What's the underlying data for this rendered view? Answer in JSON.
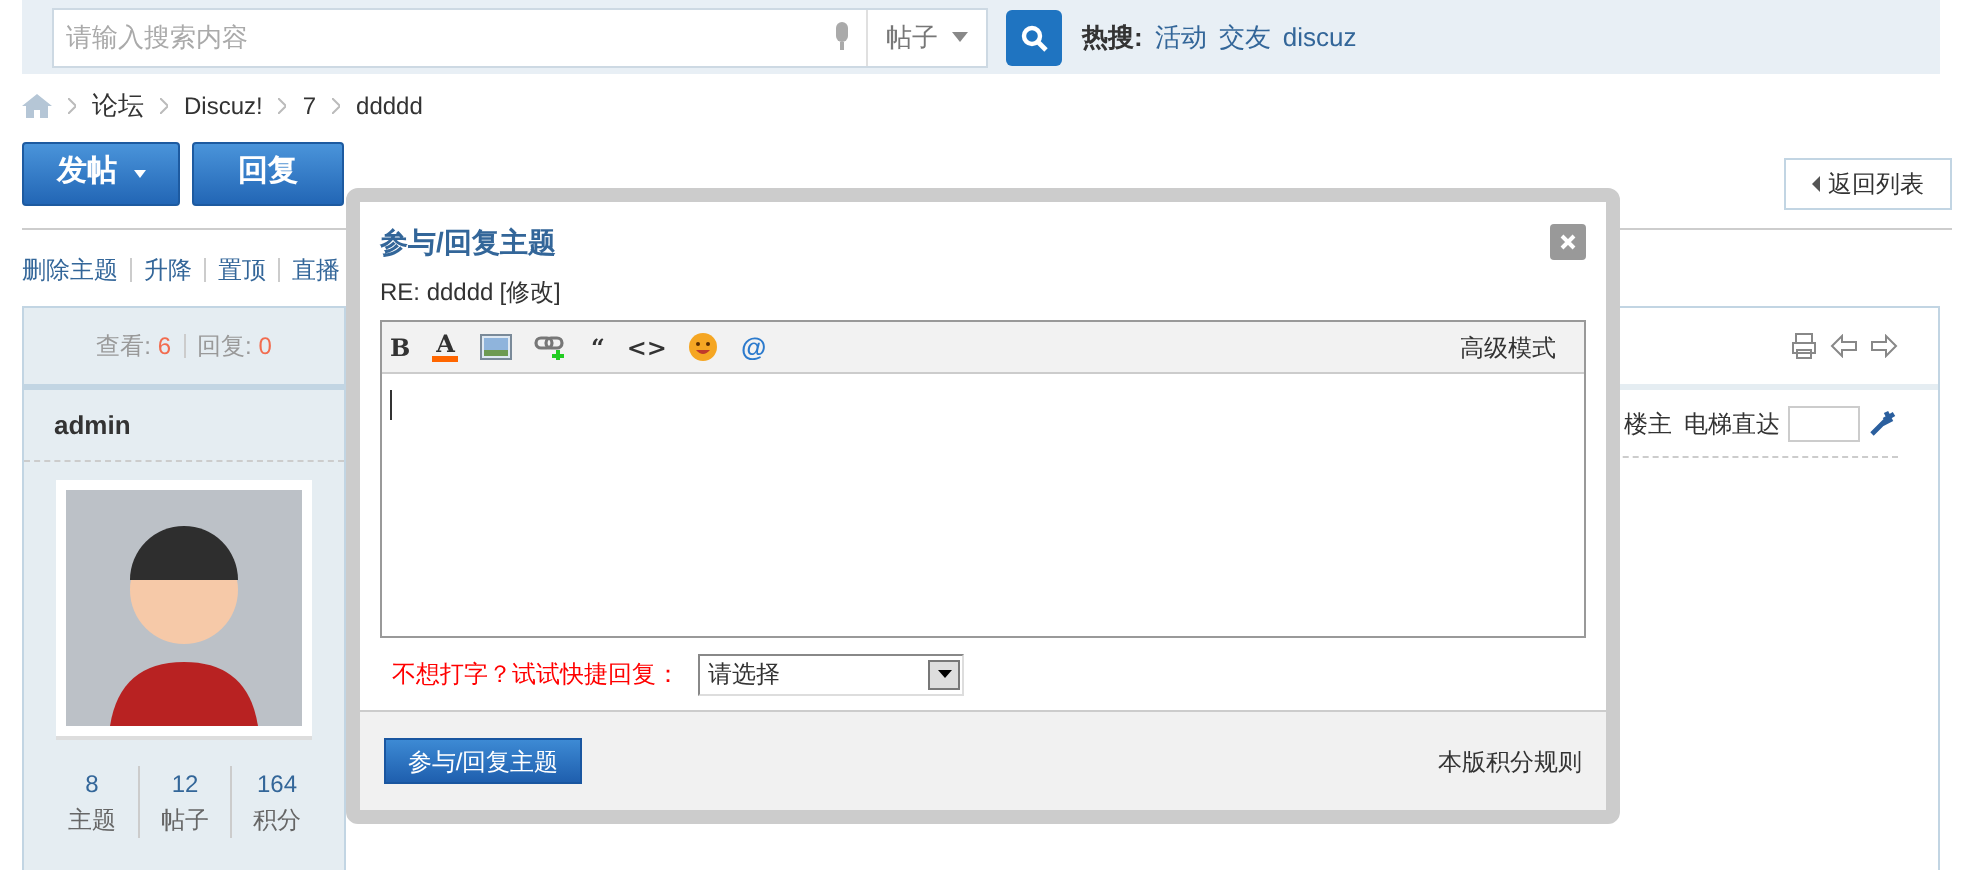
{
  "search": {
    "placeholder": "请输入搜索内容",
    "type_select": "帖子",
    "hot_label": "热搜:",
    "hot_links": [
      "活动",
      "交友",
      "discuz"
    ]
  },
  "breadcrumb": [
    "论坛",
    "Discuz!",
    "7",
    "ddddd"
  ],
  "actions": {
    "post_button": "发帖",
    "reply_button": "回复",
    "back_button": "返回列表"
  },
  "mod_actions": [
    "删除主题",
    "升降",
    "置顶",
    "直播"
  ],
  "thread_stats": [
    {
      "label": "查看:",
      "value": "6"
    },
    {
      "label": "回复:",
      "value": "0"
    }
  ],
  "author": {
    "name": "admin",
    "stats": [
      {
        "value": "8",
        "label": "主题"
      },
      {
        "value": "12",
        "label": "帖子"
      },
      {
        "value": "164",
        "label": "积分"
      }
    ]
  },
  "post_tools": {
    "op_label": "楼主",
    "jump_label": "电梯直达"
  },
  "dialog": {
    "title": "参与/回复主题",
    "subject": "RE: ddddd",
    "edit_link": "[修改]",
    "toolbar": [
      {
        "kind": "glyph",
        "text": "B"
      },
      {
        "kind": "color",
        "text": "A"
      },
      {
        "kind": "image"
      },
      {
        "kind": "link"
      },
      {
        "kind": "glyph",
        "text": "“"
      },
      {
        "kind": "glyph",
        "text": "<>"
      },
      {
        "kind": "emoji"
      },
      {
        "kind": "at",
        "text": "@"
      }
    ],
    "advanced_mode": "高级模式",
    "quick_reply_label": "不想打字？试试快捷回复：",
    "quick_reply_select": "请选择",
    "submit": "参与/回复主题",
    "rules_link": "本版积分规则"
  }
}
